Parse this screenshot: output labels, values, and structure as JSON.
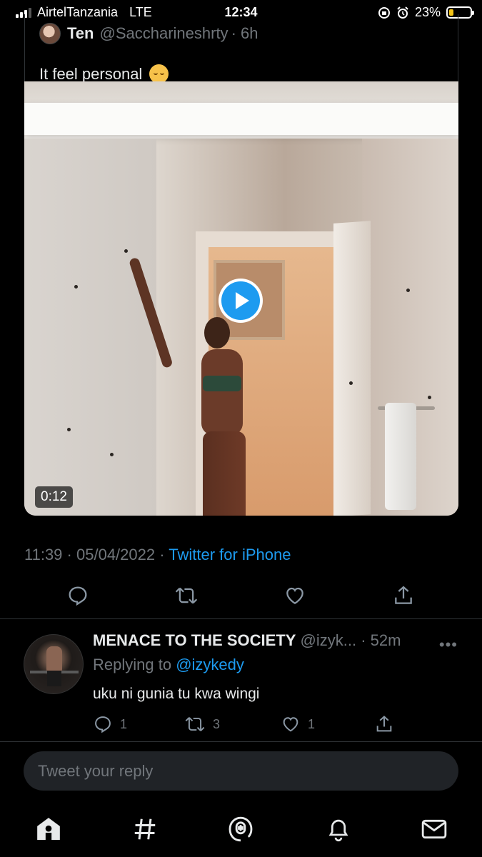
{
  "status_bar": {
    "carrier": "AirtelTanzania",
    "network": "LTE",
    "time": "12:34",
    "battery": "23%",
    "battery_level": 0.23
  },
  "quoted_tweet": {
    "name": "Ten",
    "handle": "@Saccharineshrty",
    "age": "· 6h",
    "text": "It feel personal",
    "emoji": "relieved-face-emoji"
  },
  "media": {
    "type": "video",
    "duration": "0:12"
  },
  "tweet_meta": {
    "time": "11:39",
    "date": "05/04/2022",
    "source": "Twitter for iPhone",
    "separator": "·"
  },
  "reply": {
    "name": "MENACE TO THE SOCIETY",
    "handle": "@izyk...",
    "age": "· 52m",
    "more": "•••",
    "replying_prefix": "Replying to",
    "replying_to": "@izykedy",
    "text": "uku ni gunia tu kwa wingi",
    "counts": {
      "replies": "1",
      "retweets": "3",
      "likes": "1"
    }
  },
  "compose": {
    "placeholder": "Tweet your reply"
  },
  "tab_bar": {
    "items": [
      "home-icon",
      "explore-hashtag-icon",
      "spaces-icon",
      "notifications-bell-icon",
      "messages-envelope-icon"
    ]
  },
  "colors": {
    "background": "#000000",
    "accent": "#1d9bf0",
    "muted": "#71767b",
    "text": "#e7e9ea",
    "divider": "#2f3336",
    "battery": "#f5c518"
  }
}
